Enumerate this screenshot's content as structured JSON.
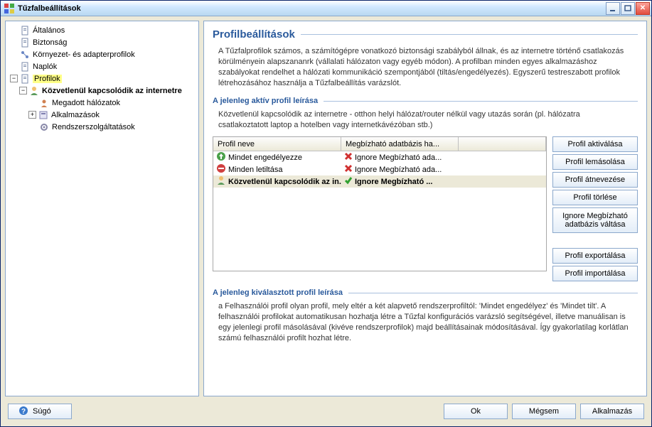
{
  "window": {
    "title": "Tűzfalbeállítások"
  },
  "tree": {
    "items": [
      {
        "label": "Általános",
        "depth": 0,
        "icon": "doc"
      },
      {
        "label": "Biztonság",
        "depth": 0,
        "icon": "doc"
      },
      {
        "label": "Környezet- és adapterprofilok",
        "depth": 0,
        "icon": "net"
      },
      {
        "label": "Naplók",
        "depth": 0,
        "icon": "doc"
      },
      {
        "label": "Profilok",
        "depth": 0,
        "icon": "doc",
        "highlight": true,
        "expanded": true
      },
      {
        "label": "Közvetlenül kapcsolódik az internetre",
        "depth": 1,
        "icon": "user",
        "bold": true,
        "expanded": true
      },
      {
        "label": "Megadott hálózatok",
        "depth": 2,
        "icon": "person"
      },
      {
        "label": "Alkalmazások",
        "depth": 2,
        "icon": "app",
        "expandable": true
      },
      {
        "label": "Rendszerszolgáltatások",
        "depth": 2,
        "icon": "svc"
      }
    ]
  },
  "main": {
    "heading": "Profilbeállítások",
    "intro": "A Tűzfalprofilok számos, a számítógépre vonatkozó biztonsági szabályból állnak, és az internetre történő csatlakozás körülményein alapszananrk (vállalati hálózaton vagy egyéb módon). A profilban minden egyes alkalmazáshoz szabályokat rendelhet a hálózati kommunikáció szempontjából (tiltás/engedélyezés). Egyszerű testreszabott profilok létrehozásához használja a Tűzfalbeállítás varázslót.",
    "active_heading": "A jelenleg aktív profil leírása",
    "active_text": "Közvetlenül kapcsolódik az internetre - otthon helyi hálózat/router nélkül vagy utazás során (pl. hálózatra csatlakoztatott laptop a hotelben vagy internetkávézóban stb.)",
    "table": {
      "cols": [
        "Profil neve",
        "Megbízható adatbázis  ha...",
        ""
      ],
      "rows": [
        {
          "name": "Mindet engedélyezze",
          "trust": "Ignore Megbízható ada...",
          "icon": "up",
          "mark": "x"
        },
        {
          "name": "Minden letiltása",
          "trust": "Ignore Megbízható ada...",
          "icon": "down",
          "mark": "x"
        },
        {
          "name": "Közvetlenül kapcsolódik az in...",
          "trust": "Ignore Megbízható ...",
          "icon": "user",
          "mark": "check",
          "selected": true
        }
      ]
    },
    "buttons": {
      "activate": "Profil aktiválása",
      "clone": "Profil lemásolása",
      "rename": "Profil átnevezése",
      "delete": "Profil törlése",
      "toggle_trust": "Ignore Megbízható adatbázis  váltása",
      "export": "Profil exportálása",
      "import": "Profil importálása"
    },
    "selected_heading": "A jelenleg kiválasztott profil leírása",
    "selected_text": "a Felhasználói profil olyan profil, mely eltér a két alapvető rendszerprofiltól: 'Mindet engedélyez' és 'Mindet tilt'. A felhasználói profilokat automatikusan hozhatja létre a Tűzfal konfigurációs varázsló segítségével, illetve manuálisan is egy jelenlegi profil másolásával (kivéve rendszerprofilok) majd beállításainak módosításával. Így gyakorlatilag korlátlan számú felhasználói profilt hozhat létre."
  },
  "footer": {
    "help": "Súgó",
    "ok": "Ok",
    "cancel": "Mégsem",
    "apply": "Alkalmazás"
  }
}
